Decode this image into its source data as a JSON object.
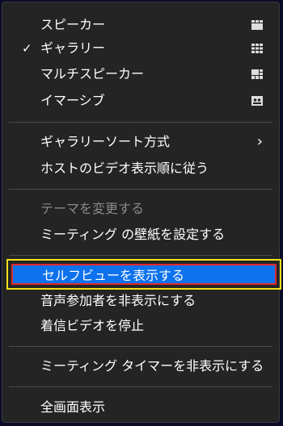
{
  "menu": {
    "view_modes": [
      {
        "label": "スピーカー",
        "checked": false,
        "icon": "speaker-view-icon"
      },
      {
        "label": "ギャラリー",
        "checked": true,
        "icon": "gallery-view-icon"
      },
      {
        "label": "マルチスピーカー",
        "checked": false,
        "icon": "multi-speaker-view-icon"
      },
      {
        "label": "イマーシブ",
        "checked": false,
        "icon": "immersive-view-icon"
      }
    ],
    "check_mark": "✓",
    "gallery_sort": {
      "label": "ギャラリーソート方式",
      "icon": "chevron-right-icon"
    },
    "follow_host": {
      "label": "ホストのビデオ表示順に従う"
    },
    "change_theme": {
      "label": "テーマを変更する",
      "disabled": true
    },
    "set_wallpaper": {
      "label": "ミーティング の壁紙を設定する"
    },
    "show_self_view": {
      "label": "セルフビューを表示する",
      "highlighted": true
    },
    "hide_audio_participants": {
      "label": "音声参加者を非表示にする"
    },
    "stop_incoming_video": {
      "label": "着信ビデオを停止"
    },
    "hide_meeting_timer": {
      "label": "ミーティング タイマーを非表示にする"
    },
    "fullscreen": {
      "label": "全画面表示"
    }
  },
  "colors": {
    "menu_background": "#242424",
    "highlight": "#0e72ed",
    "outer_frame": "#f2e21a",
    "inner_frame": "#e0282e",
    "disabled_text": "#8a8a8a"
  }
}
